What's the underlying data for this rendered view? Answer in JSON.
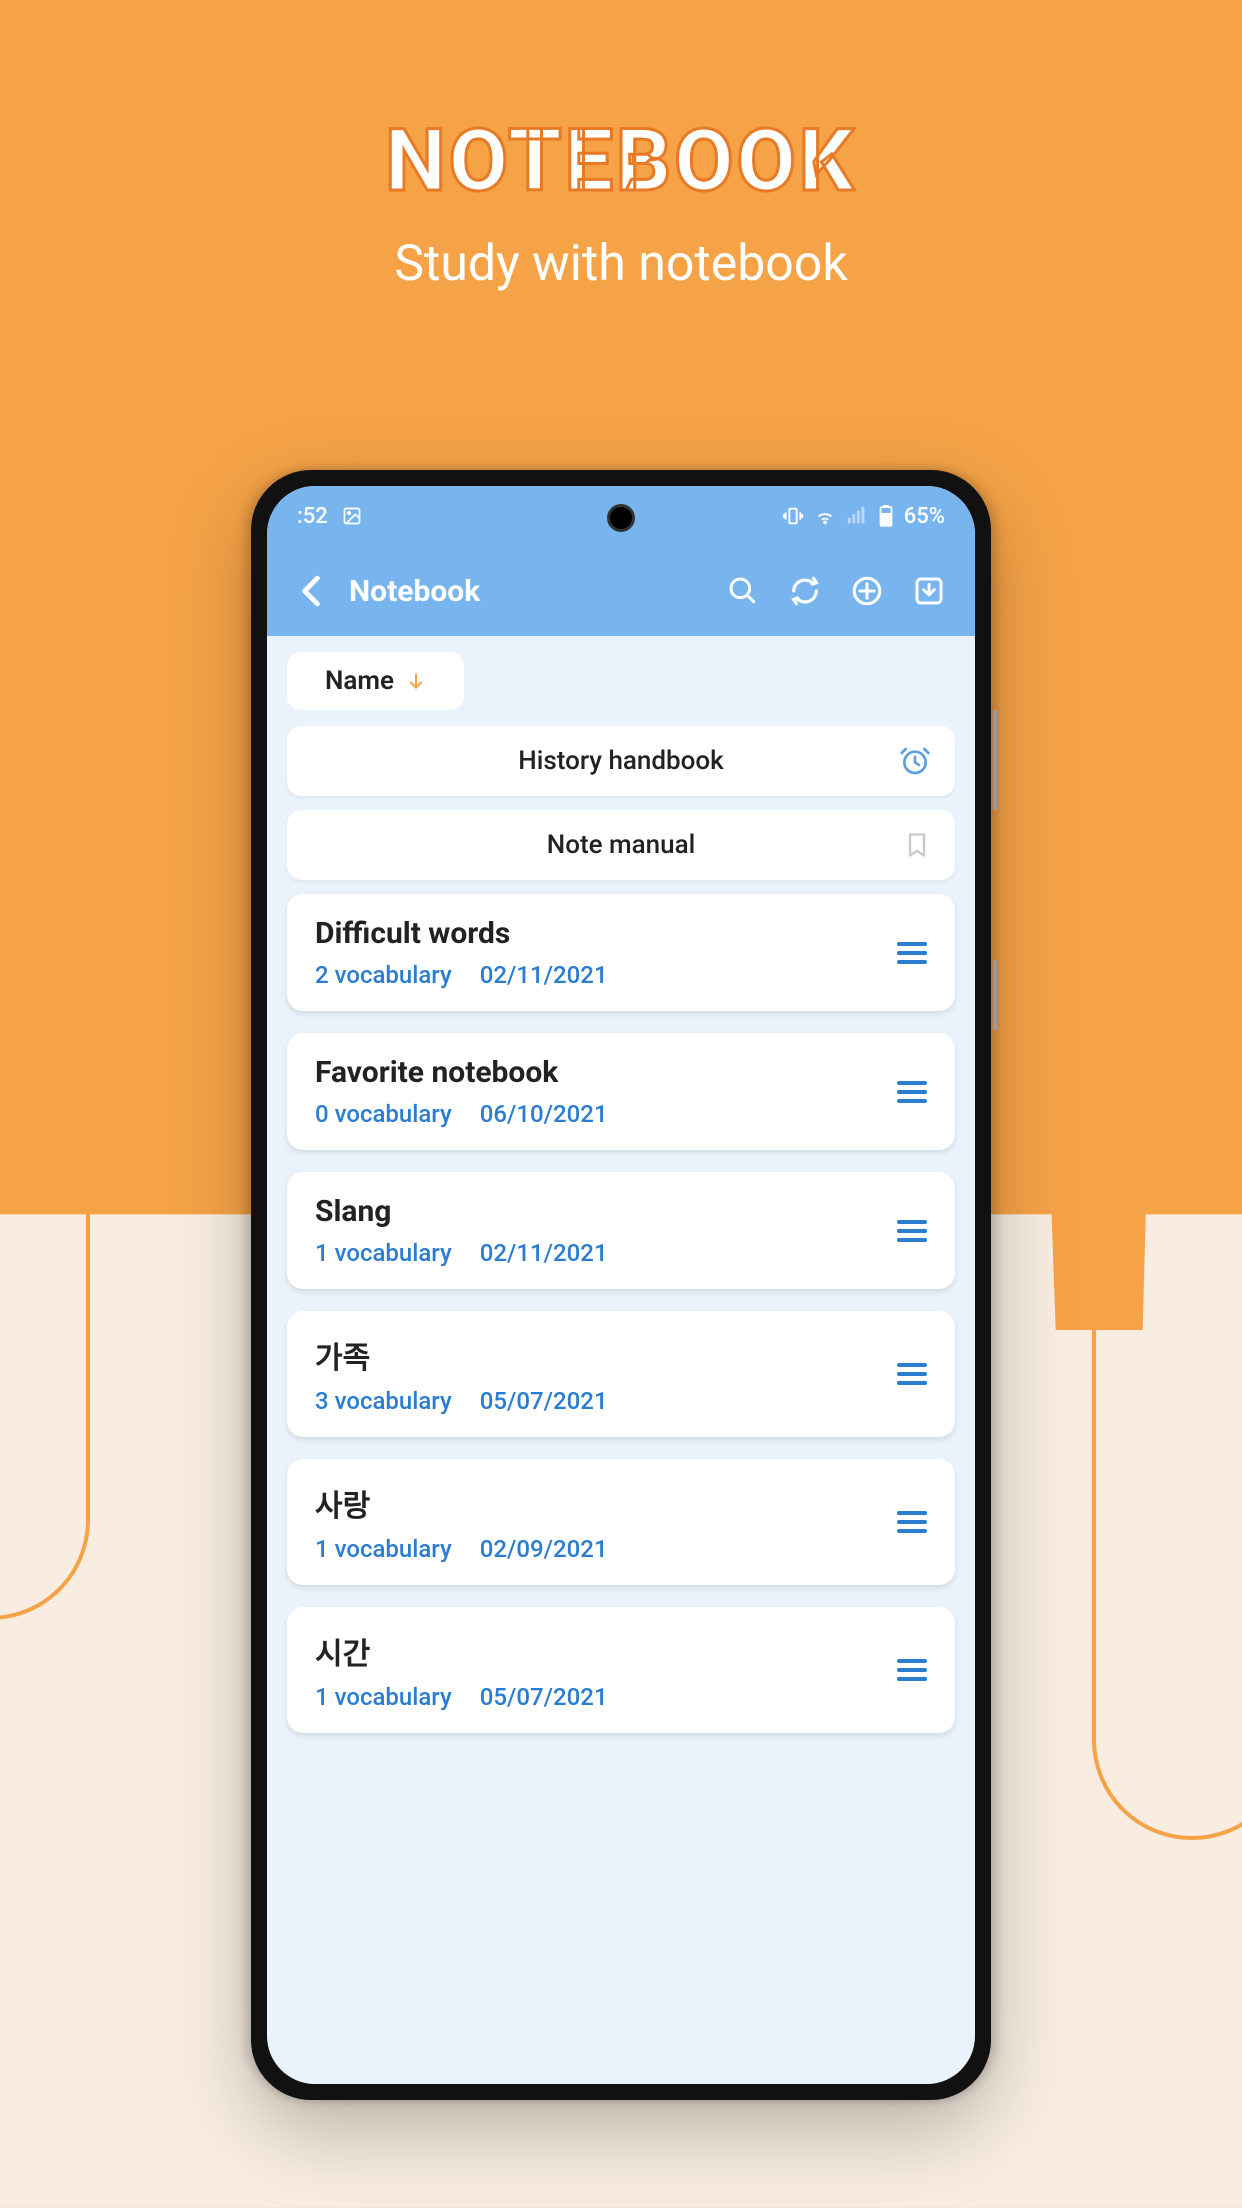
{
  "promo": {
    "title": "NOTEBOOK",
    "subtitle": "Study with notebook"
  },
  "status_bar": {
    "time": ":52",
    "battery": "65%"
  },
  "app_bar": {
    "title": "Notebook"
  },
  "sort": {
    "label": "Name"
  },
  "banners": {
    "history": "History handbook",
    "manual": "Note manual"
  },
  "notebooks": [
    {
      "title": "Difficult words",
      "count": "2 vocabulary",
      "date": "02/11/2021"
    },
    {
      "title": "Favorite notebook",
      "count": "0 vocabulary",
      "date": "06/10/2021"
    },
    {
      "title": "Slang",
      "count": "1 vocabulary",
      "date": "02/11/2021"
    },
    {
      "title": "가족",
      "count": "3 vocabulary",
      "date": "05/07/2021"
    },
    {
      "title": "사랑",
      "count": "1 vocabulary",
      "date": "02/09/2021"
    },
    {
      "title": "시간",
      "count": "1 vocabulary",
      "date": "05/07/2021"
    }
  ]
}
